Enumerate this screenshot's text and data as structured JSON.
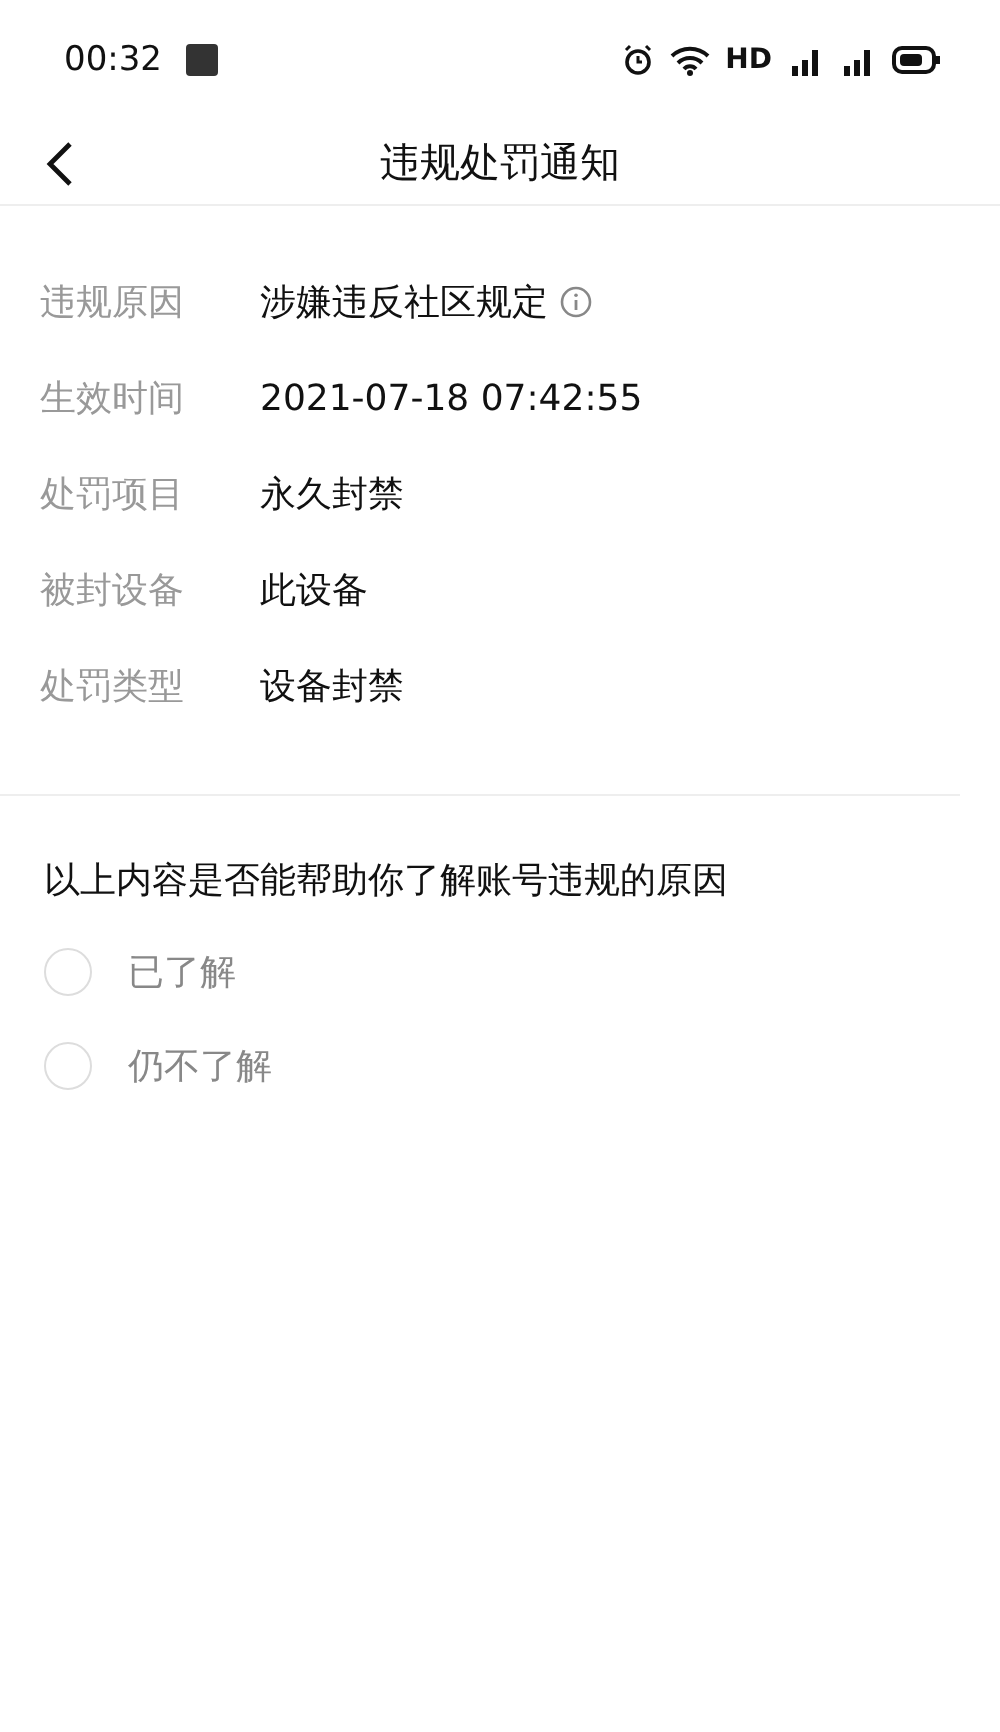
{
  "status_bar": {
    "time": "00:32",
    "network_label": "HD"
  },
  "nav": {
    "title": "违规处罚通知"
  },
  "details": [
    {
      "label": "违规原因",
      "value": "涉嫌违反社区规定",
      "kind": "info"
    },
    {
      "label": "生效时间",
      "value": "2021-07-18 07:42:55",
      "kind": "plain"
    },
    {
      "label": "处罚项目",
      "value": "永久封禁",
      "kind": "plain"
    },
    {
      "label": "被封设备",
      "value": "此设备",
      "kind": "plain"
    },
    {
      "label": "处罚类型",
      "value": "设备封禁",
      "kind": "plain"
    }
  ],
  "survey": {
    "question": "以上内容是否能帮助你了解账号违规的原因",
    "options": [
      {
        "label": "已了解",
        "selected": false
      },
      {
        "label": "仍不了解",
        "selected": false
      }
    ]
  }
}
